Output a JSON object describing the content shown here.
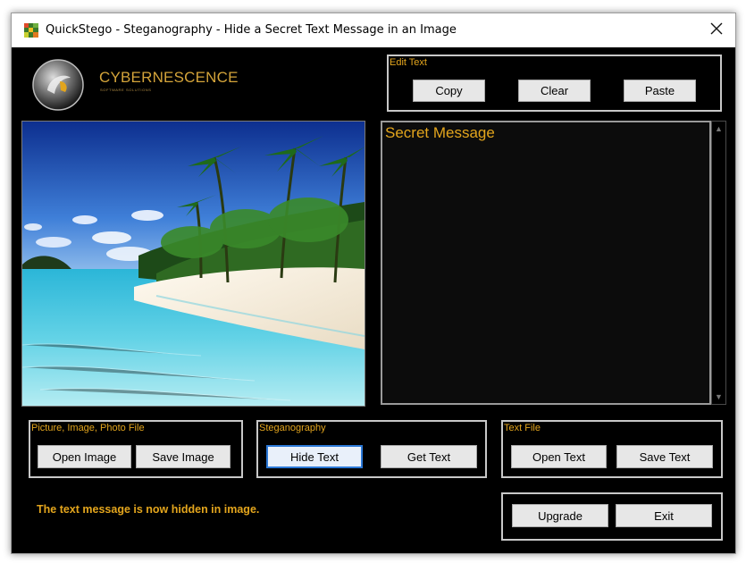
{
  "window": {
    "title": "QuickStego - Steganography - Hide a Secret Text Message in an Image",
    "close_glyph": "✕"
  },
  "logo": {
    "name": "CYBERNESCENCE",
    "subtitle": "SOFTWARE SOLUTIONS"
  },
  "edit_text": {
    "title": "Edit Text",
    "copy_label": "Copy",
    "clear_label": "Clear",
    "paste_label": "Paste"
  },
  "message": {
    "value": "Secret Message"
  },
  "picture_group": {
    "title": "Picture, Image, Photo File",
    "open_label": "Open Image",
    "save_label": "Save Image"
  },
  "stego_group": {
    "title": "Steganography",
    "hide_label": "Hide Text",
    "get_label": "Get Text"
  },
  "text_file_group": {
    "title": "Text File",
    "open_label": "Open Text",
    "save_label": "Save Text"
  },
  "footer": {
    "status": "The text message is now hidden in image.",
    "upgrade_label": "Upgrade",
    "exit_label": "Exit"
  },
  "colors": {
    "accent": "#e3a51d",
    "background": "#000000",
    "button_face": "#e7e7e7",
    "focus_border": "#2b78d6"
  },
  "icons": [
    "app-icon",
    "close-icon",
    "logo-orb-icon",
    "scroll-up-icon",
    "scroll-down-icon"
  ]
}
